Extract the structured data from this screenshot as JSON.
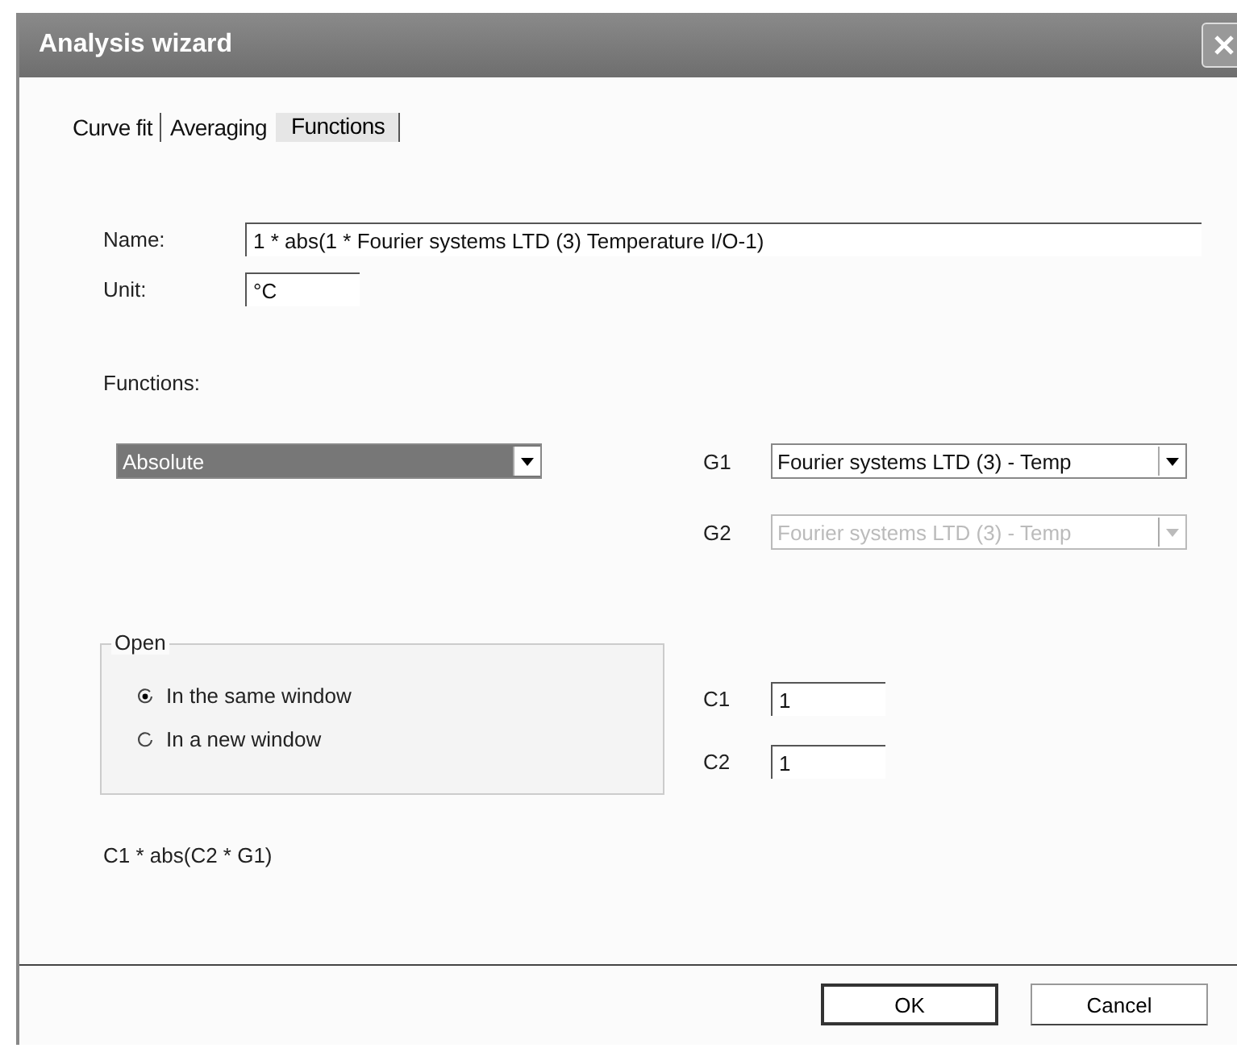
{
  "window": {
    "title": "Analysis wizard"
  },
  "tabs": [
    {
      "label": "Curve fit",
      "selected": false
    },
    {
      "label": "Averaging",
      "selected": false
    },
    {
      "label": "Functions",
      "selected": true
    }
  ],
  "name": {
    "label": "Name:",
    "value": "1 * abs(1 * Fourier systems LTD (3) Temperature I/O-1)"
  },
  "unit": {
    "label": "Unit:",
    "value": "°C"
  },
  "functions": {
    "label": "Functions:",
    "value": "Absolute"
  },
  "graphs": [
    {
      "label": "G1",
      "value": "Fourier systems LTD (3) - Temp",
      "disabled": false
    },
    {
      "label": "G2",
      "value": "Fourier systems LTD (3) - Temp",
      "disabled": true
    }
  ],
  "open": {
    "title": "Open",
    "options": [
      {
        "label": "In the same window",
        "selected": true
      },
      {
        "label": "In a new window",
        "selected": false
      }
    ]
  },
  "constants": [
    {
      "label": "C1",
      "value": "1"
    },
    {
      "label": "C2",
      "value": "1"
    }
  ],
  "formula": "C1 * abs(C2 * G1)",
  "buttons": [
    "OK",
    "Cancel"
  ]
}
